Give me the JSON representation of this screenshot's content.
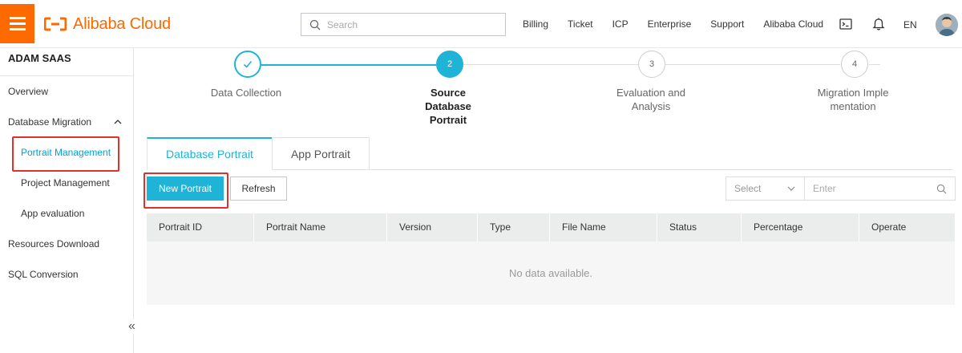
{
  "brand": {
    "name": "Alibaba Cloud",
    "accent": "#ff6a00",
    "primary": "#1fb4d7"
  },
  "header": {
    "search_placeholder": "Search",
    "nav": [
      "Billing",
      "Ticket",
      "ICP",
      "Enterprise",
      "Support",
      "Alibaba Cloud"
    ],
    "icons": [
      "terminal-icon",
      "bell-icon"
    ],
    "lang": "EN"
  },
  "sidebar": {
    "title": "ADAM SAAS",
    "items": [
      {
        "label": "Overview"
      },
      {
        "label": "Database Migration",
        "expanded": true
      },
      {
        "label": "Portrait Management",
        "active": true
      },
      {
        "label": "Project Management"
      },
      {
        "label": "App evaluation"
      },
      {
        "label": "Resources Download"
      },
      {
        "label": "SQL Conversion"
      }
    ],
    "collapse_glyph": "«"
  },
  "steps": [
    {
      "number": "✓",
      "label": "Data Collection",
      "state": "done"
    },
    {
      "number": "2",
      "label": "Source Database Portrait",
      "state": "current"
    },
    {
      "number": "3",
      "label": "Evaluation and Analysis",
      "state": "pending"
    },
    {
      "number": "4",
      "label": "Migration Implementation",
      "state": "pending"
    }
  ],
  "tabs": [
    {
      "label": "Database Portrait",
      "active": true
    },
    {
      "label": "App Portrait",
      "active": false
    }
  ],
  "toolbar": {
    "new_label": "New Portrait",
    "refresh_label": "Refresh",
    "select_placeholder": "Select",
    "filter_placeholder": "Enter"
  },
  "table": {
    "columns": [
      "Portrait ID",
      "Portrait Name",
      "Version",
      "Type",
      "File Name",
      "Status",
      "Percentage",
      "Operate"
    ],
    "empty_text": "No data available."
  }
}
